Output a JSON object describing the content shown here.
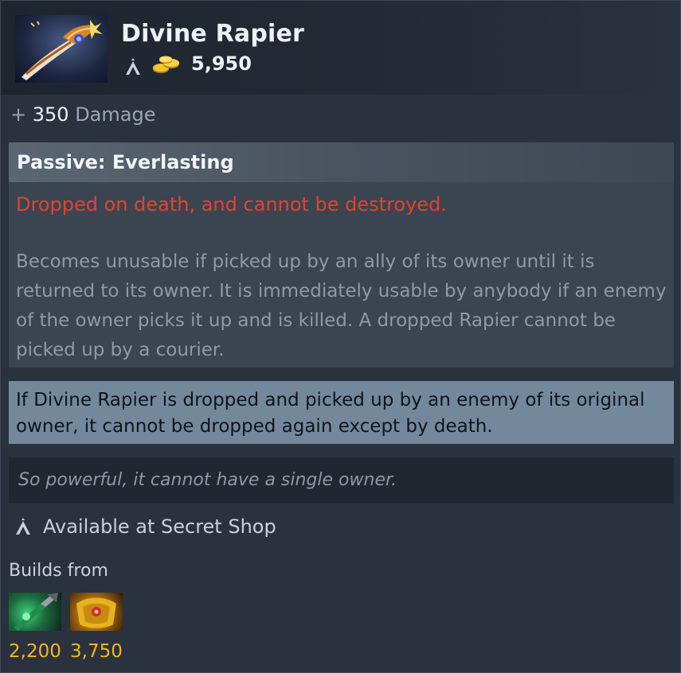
{
  "item": {
    "name": "Divine Rapier",
    "icon": "divine-rapier-icon",
    "cost": "5,950"
  },
  "stat": {
    "plus": "+",
    "value": "350",
    "label": "Damage"
  },
  "ability": {
    "title": "Passive: Everlasting",
    "warning": "Dropped on death, and cannot be destroyed.",
    "description": "Becomes unusable if picked up by an ally of its owner until it is returned to its owner. It is immediately usable by anybody if an enemy of the owner picks it up and is killed. A dropped Rapier cannot be picked up by a courier."
  },
  "note": "If Divine Rapier is dropped and picked up by an enemy of its original owner, it cannot be dropped again except by death.",
  "lore": "So powerful, it cannot have a single owner.",
  "availability": "Available at Secret Shop",
  "builds": {
    "label": "Builds from",
    "components": [
      {
        "icon": "component-green-item-icon",
        "cost": "2,200"
      },
      {
        "icon": "component-gold-item-icon",
        "cost": "3,750"
      }
    ]
  },
  "colors": {
    "warning_red": "#e2432f",
    "gold_cost": "#f0b81c",
    "note_bg": "#74889c"
  }
}
